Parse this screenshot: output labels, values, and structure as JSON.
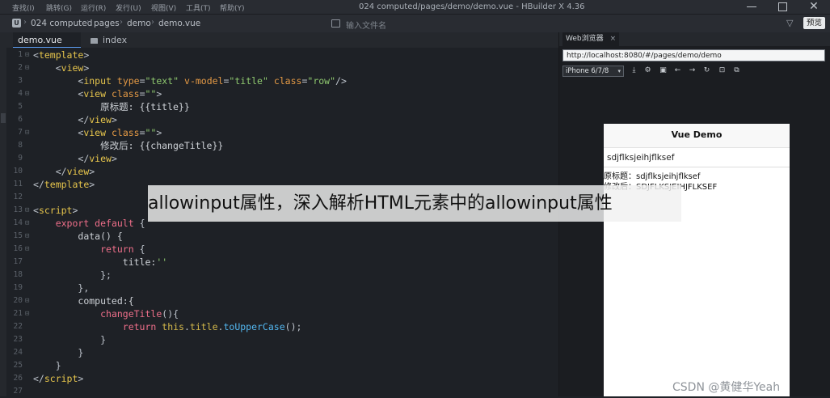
{
  "menubar": {
    "menus": [
      "查找(I)",
      "跳转(G)",
      "运行(R)",
      "发行(U)",
      "视图(V)",
      "工具(T)",
      "帮助(Y)"
    ],
    "window_title": "024 computed/pages/demo/demo.vue - HBuilder X 4.36"
  },
  "toolbar": {
    "project_icon": "U",
    "breadcrumbs": [
      "024 computed",
      "pages",
      "demo",
      "demo.vue"
    ],
    "file_search_placeholder": "输入文件名",
    "preview_label": "预览"
  },
  "editor": {
    "tabs": [
      {
        "label": "demo.vue",
        "active": true
      },
      {
        "label": "index",
        "active": false
      }
    ]
  },
  "browser": {
    "tab_label": "Web浏览器",
    "tab_close": "×",
    "url": "http://localhost:8080/#/pages/demo/demo",
    "device": "iPhone 6/7/8",
    "icons": [
      "screenshot-icon",
      "settings-icon",
      "devtools-icon",
      "back-icon",
      "forward-icon",
      "refresh-icon",
      "lock-icon",
      "copy-icon"
    ]
  },
  "phone": {
    "nav_title": "Vue Demo",
    "input_value": "sdjflksjeihjflksef",
    "rows": [
      "原标题：sdjflksjeihjflksef",
      "修改后：SDJFLKSJEIHJFLKSEF"
    ]
  },
  "overlay": {
    "banner": "allowinput属性，深入解析HTML元素中的allowinput属性",
    "watermark": "CSDN @黄健华Yeah"
  },
  "colors": {
    "editor_bg": "#1e2126",
    "chrome_bg": "#292c32",
    "tag": "#e6c54c",
    "attr": "#e59a45",
    "string": "#8fc96f",
    "keyword": "#ef6f8a",
    "function": "#53b7f0"
  }
}
